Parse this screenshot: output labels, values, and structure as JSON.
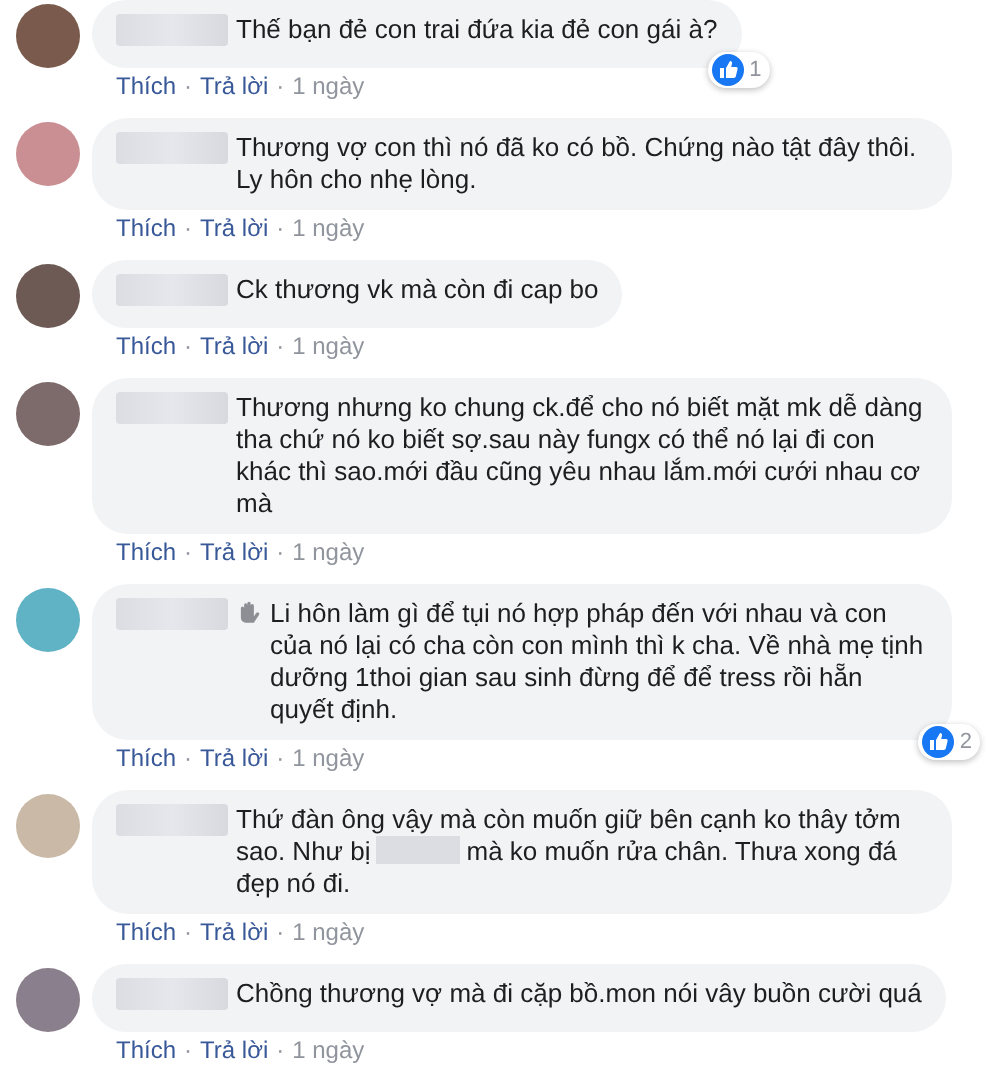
{
  "comments": [
    {
      "color": "#7a5a4c",
      "parts": [
        {
          "kind": "text",
          "text": "Thế bạn đẻ con trai đứa kia đẻ con gái à?"
        }
      ],
      "leading_icon": false,
      "likes": "1",
      "actions": [
        {
          "kind": "link",
          "label": "Thích"
        },
        {
          "kind": "dot",
          "label": "·"
        },
        {
          "kind": "link",
          "label": "Trả lời"
        },
        {
          "kind": "dot",
          "label": "·"
        }
      ],
      "time": "1 ngày"
    },
    {
      "color": "#c98f93",
      "parts": [
        {
          "kind": "text",
          "text": "Thương vợ con thì nó đã ko có bồ. Chứng nào tật đây thôi. Ly hôn cho nhẹ lòng."
        }
      ],
      "leading_icon": false,
      "actions": [
        {
          "kind": "link",
          "label": "Thích"
        },
        {
          "kind": "dot",
          "label": "·"
        },
        {
          "kind": "link",
          "label": "Trả lời"
        },
        {
          "kind": "dot",
          "label": "·"
        }
      ],
      "time": "1 ngày"
    },
    {
      "color": "#6e5a55",
      "parts": [
        {
          "kind": "text",
          "text": "Ck thương vk mà còn đi cap bo"
        }
      ],
      "leading_icon": false,
      "actions": [
        {
          "kind": "link",
          "label": "Thích"
        },
        {
          "kind": "dot",
          "label": "·"
        },
        {
          "kind": "link",
          "label": "Trả lời"
        },
        {
          "kind": "dot",
          "label": "·"
        }
      ],
      "time": "1 ngày"
    },
    {
      "color": "#7d6a6a",
      "parts": [
        {
          "kind": "text",
          "text": "Thương nhưng ko chung ck.để cho nó biết mặt mk dễ dàng tha chứ nó ko biết sợ.sau này fungx có thể nó lại đi con khác thì sao.mới đầu cũng yêu nhau lắm.mới cưới nhau cơ mà"
        }
      ],
      "leading_icon": false,
      "actions": [
        {
          "kind": "link",
          "label": "Thích"
        },
        {
          "kind": "dot",
          "label": "·"
        },
        {
          "kind": "link",
          "label": "Trả lời"
        },
        {
          "kind": "dot",
          "label": "·"
        }
      ],
      "time": "1 ngày"
    },
    {
      "color": "#5fb3c4",
      "parts": [
        {
          "kind": "text",
          "text": "Li hôn làm gì để tụi nó hợp pháp đến với nhau và con của nó lại có cha còn con mình thì k cha. Về nhà mẹ tịnh dưỡng 1thoi gian sau sinh đừng để để tress rồi hẵn quyết định."
        }
      ],
      "leading_icon": true,
      "likes": "2",
      "actions": [
        {
          "kind": "link",
          "label": "Thích"
        },
        {
          "kind": "dot",
          "label": "·"
        },
        {
          "kind": "link",
          "label": "Trả lời"
        },
        {
          "kind": "dot",
          "label": "·"
        }
      ],
      "time": "1 ngày"
    },
    {
      "color": "#c9b9a6",
      "parts": [
        {
          "kind": "text",
          "text": "Thứ đàn ông vậy mà còn muốn giữ bên cạnh ko thây tởm sao. Như bị"
        },
        {
          "kind": "redacted"
        },
        {
          "kind": "text",
          "text": "mà ko muốn rửa chân. Thưa xong đá đẹp nó đi."
        }
      ],
      "leading_icon": false,
      "actions": [
        {
          "kind": "link",
          "label": "Thích"
        },
        {
          "kind": "dot",
          "label": "·"
        },
        {
          "kind": "link",
          "label": "Trả lời"
        },
        {
          "kind": "dot",
          "label": "·"
        }
      ],
      "time": "1 ngày"
    },
    {
      "color": "#8a7f8c",
      "parts": [
        {
          "kind": "text",
          "text": "Chồng thương vợ mà đi cặp bồ.mon nói vây buồn cười quá"
        }
      ],
      "leading_icon": false,
      "actions": [
        {
          "kind": "link",
          "label": "Thích"
        },
        {
          "kind": "dot",
          "label": "·"
        },
        {
          "kind": "link",
          "label": "Trả lời"
        },
        {
          "kind": "dot",
          "label": "·"
        }
      ],
      "time": "1 ngày"
    }
  ]
}
